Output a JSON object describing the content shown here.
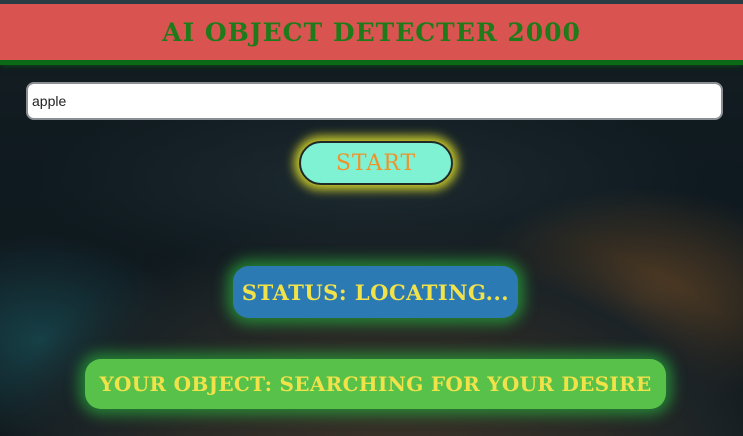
{
  "header": {
    "title": "AI OBJECT DETECTER 2000"
  },
  "search": {
    "value": "apple"
  },
  "controls": {
    "start_label": "START"
  },
  "status": {
    "text": "STATUS: LOCATING..."
  },
  "result": {
    "text": "YOUR OBJECT: SEARCHING FOR YOUR DESIRE"
  },
  "colors": {
    "header_bg": "#d95450",
    "header_text": "#1f7a1a",
    "start_bg": "#7ff2d4",
    "start_text": "#f0922a",
    "status_bg": "#2c7ab4",
    "result_bg": "#58c14a",
    "badge_text": "#f2e24a",
    "glow": "#28aa3c"
  }
}
